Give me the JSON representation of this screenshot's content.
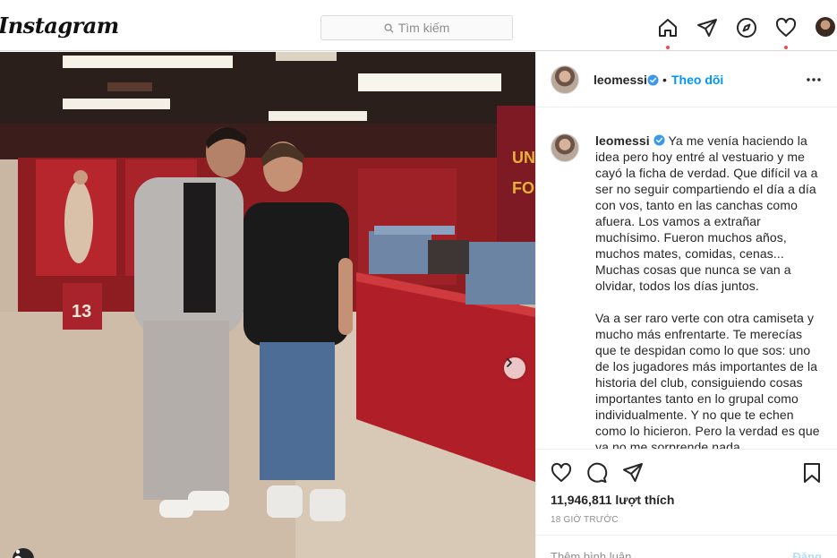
{
  "app": {
    "logo_text": "Instagram",
    "search_placeholder": "Tìm kiếm"
  },
  "nav": {
    "icons": [
      "home-icon",
      "direct-icon",
      "explore-icon",
      "activity-heart-icon",
      "profile-avatar"
    ],
    "notification_color": "#ed4956"
  },
  "post": {
    "header": {
      "username": "leomessi",
      "follow_label": "Theo dõi",
      "separator": "•"
    },
    "caption": {
      "username": "leomessi",
      "paragraph_1": "Ya me venía haciendo la idea pero hoy entré al vestuario y me cayó la ficha de verdad. Que difícil va a ser no seguir compartiendo el día a día con vos, tanto en las canchas como afuera. Los vamos a extrañar muchísimo. Fueron muchos años, muchos mates, comidas, cenas... Muchas cosas que nunca se van a olvidar, todos los días juntos.",
      "paragraph_2": "Va a ser raro verte con otra camiseta y mucho más enfrentarte. Te merecías que te despidan como lo que sos: uno de los jugadores más importantes de la historia del club, consiguiendo cosas importantes tanto en lo grupal como individualmente. Y no que te echen como lo hicieron. Pero la verdad es que ya no me sorprende nada."
    },
    "likes_text": "11,946,811 lượt thích",
    "time_text": "18 GIỜ TRƯỚC",
    "comment_placeholder": "Thêm bình luận...",
    "post_button": "Đăng",
    "photo": {
      "jersey_number": "13",
      "wall_text_1": "UNI",
      "wall_text_2": "FOR"
    }
  },
  "colors": {
    "accent": "#0095f6",
    "verified": "#3897f0",
    "border": "#dbdbdb"
  }
}
